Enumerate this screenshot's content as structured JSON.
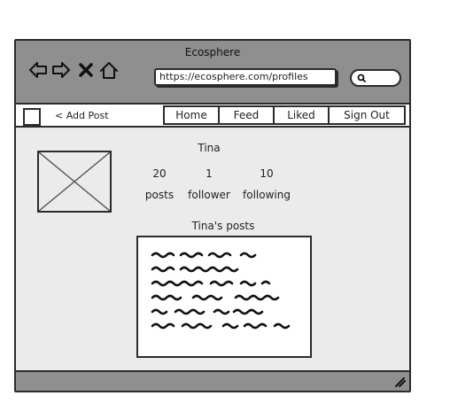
{
  "window": {
    "title": "Ecosphere"
  },
  "browser": {
    "url": "https://ecosphere.com/profiles",
    "nav_icons": [
      "back-arrow-icon",
      "forward-arrow-icon",
      "close-icon",
      "home-icon"
    ],
    "search_icon": "search-icon"
  },
  "toolbar": {
    "add_post_label": "< Add Post",
    "tabs": [
      {
        "label": "Home"
      },
      {
        "label": "Feed"
      },
      {
        "label": "Liked"
      },
      {
        "label": "Sign Out"
      }
    ]
  },
  "profile": {
    "name": "Tina",
    "avatar_icon": "image-placeholder-icon",
    "stats": [
      {
        "value": "20",
        "label": "posts"
      },
      {
        "value": "1",
        "label": "follower"
      },
      {
        "value": "10",
        "label": "following"
      }
    ],
    "posts_heading": "Tina's posts"
  },
  "colors": {
    "chrome": "#8f8f8f",
    "content_bg": "#ebebeb",
    "outline": "#2b2b2b"
  }
}
